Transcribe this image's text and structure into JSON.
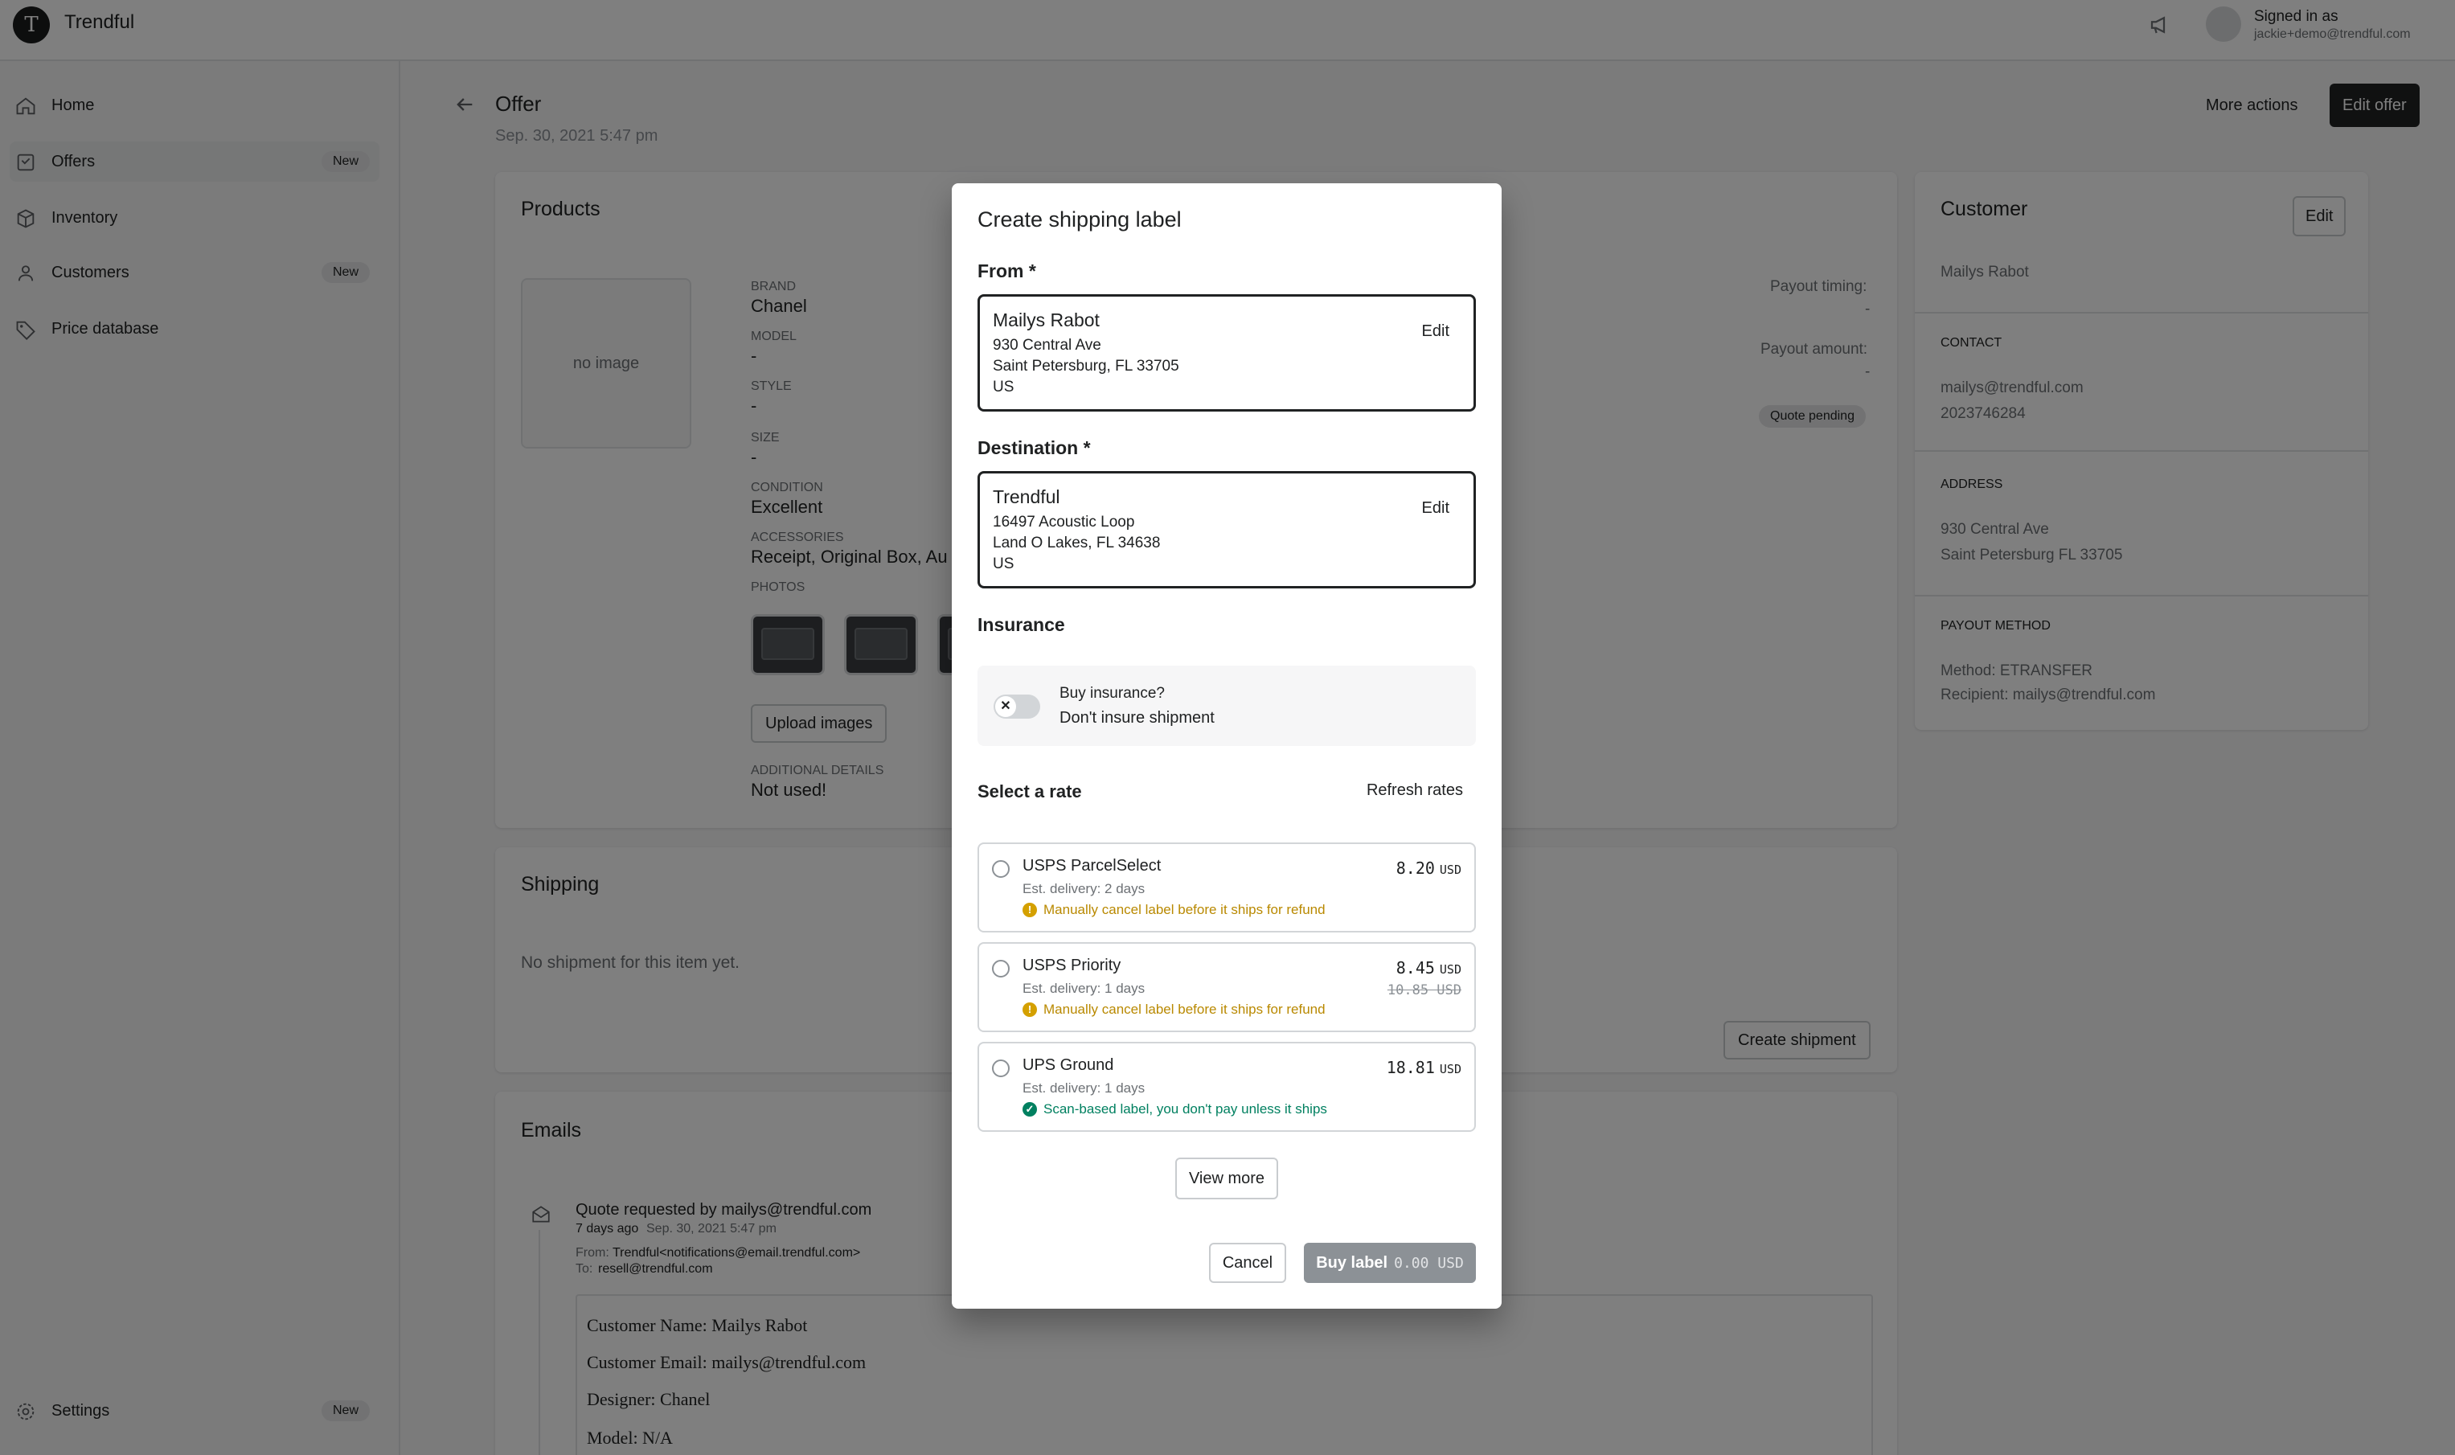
{
  "app": {
    "brand": "Trendful",
    "logo_letter": "T",
    "signed_in_label": "Signed in as",
    "user_email": "jackie+demo@trendful.com"
  },
  "sidebar": {
    "items": [
      {
        "label": "Home",
        "icon": "home-icon",
        "badge": ""
      },
      {
        "label": "Offers",
        "icon": "offers-icon",
        "badge": "New",
        "active": true
      },
      {
        "label": "Inventory",
        "icon": "box-icon",
        "badge": ""
      },
      {
        "label": "Customers",
        "icon": "customers-icon",
        "badge": "New"
      },
      {
        "label": "Price database",
        "icon": "tag-icon",
        "badge": ""
      }
    ],
    "settings": {
      "label": "Settings",
      "icon": "gear-icon",
      "badge": "New"
    }
  },
  "header": {
    "title": "Offer",
    "date": "Sep. 30, 2021 5:47 pm",
    "more_actions": "More actions",
    "edit_offer": "Edit offer"
  },
  "products": {
    "title": "Products",
    "no_image": "no image",
    "brand_label": "BRAND",
    "brand": "Chanel",
    "model_label": "MODEL",
    "model": "-",
    "style_label": "STYLE",
    "style": "-",
    "size_label": "SIZE",
    "size": "-",
    "condition_label": "CONDITION",
    "condition": "Excellent",
    "accessories_label": "ACCESSORIES",
    "accessories": "Receipt, Original Box, Au",
    "photos_label": "PHOTOS",
    "upload_images": "Upload images",
    "additional_label": "ADDITIONAL DETAILS",
    "additional": "Not used!",
    "payout_timing_label": "Payout timing:",
    "payout_timing": "-",
    "payout_amount_label": "Payout amount:",
    "payout_amount": "-",
    "quote_status": "Quote pending"
  },
  "shipping": {
    "title": "Shipping",
    "empty": "No shipment for this item yet.",
    "create_shipment": "Create shipment"
  },
  "emails": {
    "title": "Emails",
    "subject": "Quote requested by mailys@trendful.com",
    "ago": "7 days ago",
    "date": "Sep. 30, 2021 5:47 pm",
    "from_label": "From:",
    "from": "Trendful<notifications@email.trendful.com>",
    "to_label": "To:",
    "to": "resell@trendful.com",
    "body": [
      "Customer Name: Mailys Rabot",
      "Customer Email: mailys@trendful.com",
      "Designer: Chanel",
      "Model: N/A"
    ]
  },
  "customer": {
    "title": "Customer",
    "edit": "Edit",
    "name": "Mailys Rabot",
    "contact_label": "CONTACT",
    "email": "mailys@trendful.com",
    "phone": "2023746284",
    "address_label": "ADDRESS",
    "address1": "930 Central Ave",
    "address2": "Saint Petersburg FL 33705",
    "payout_label": "PAYOUT METHOD",
    "method": "Method: ETRANSFER",
    "recipient": "Recipient: mailys@trendful.com"
  },
  "modal": {
    "title": "Create shipping label",
    "from_label": "From *",
    "from": {
      "name": "Mailys Rabot",
      "line1": "930 Central Ave",
      "line2": "Saint Petersburg, FL 33705",
      "country": "US",
      "edit": "Edit"
    },
    "destination_label": "Destination *",
    "destination": {
      "name": "Trendful",
      "line1": "16497 Acoustic Loop",
      "line2": "Land O Lakes, FL 34638",
      "country": "US",
      "edit": "Edit"
    },
    "insurance_label": "Insurance",
    "insurance_question": "Buy insurance?",
    "insurance_choice": "Don't insure shipment",
    "insurance_on": false,
    "rate_label": "Select a rate",
    "refresh_rates": "Refresh rates",
    "rates": [
      {
        "name": "USPS ParcelSelect",
        "est": "Est. delivery: 2 days",
        "price": "8.20",
        "unit": "USD",
        "old_price": "",
        "note": "Manually cancel label before it ships for refund",
        "note_kind": "warning",
        "note_color": "#b98900"
      },
      {
        "name": "USPS Priority",
        "est": "Est. delivery: 1 days",
        "price": "8.45",
        "unit": "USD",
        "old_price": "10.85 USD",
        "note": "Manually cancel label before it ships for refund",
        "note_kind": "warning",
        "note_color": "#b98900"
      },
      {
        "name": "UPS Ground",
        "est": "Est. delivery: 1 days",
        "price": "18.81",
        "unit": "USD",
        "old_price": "",
        "note": "Scan-based label, you don't pay unless it ships",
        "note_kind": "success",
        "note_color": "#008060"
      }
    ],
    "view_more": "View more",
    "cancel": "Cancel",
    "buy_label": "Buy label",
    "buy_amount": "0.00 USD"
  }
}
